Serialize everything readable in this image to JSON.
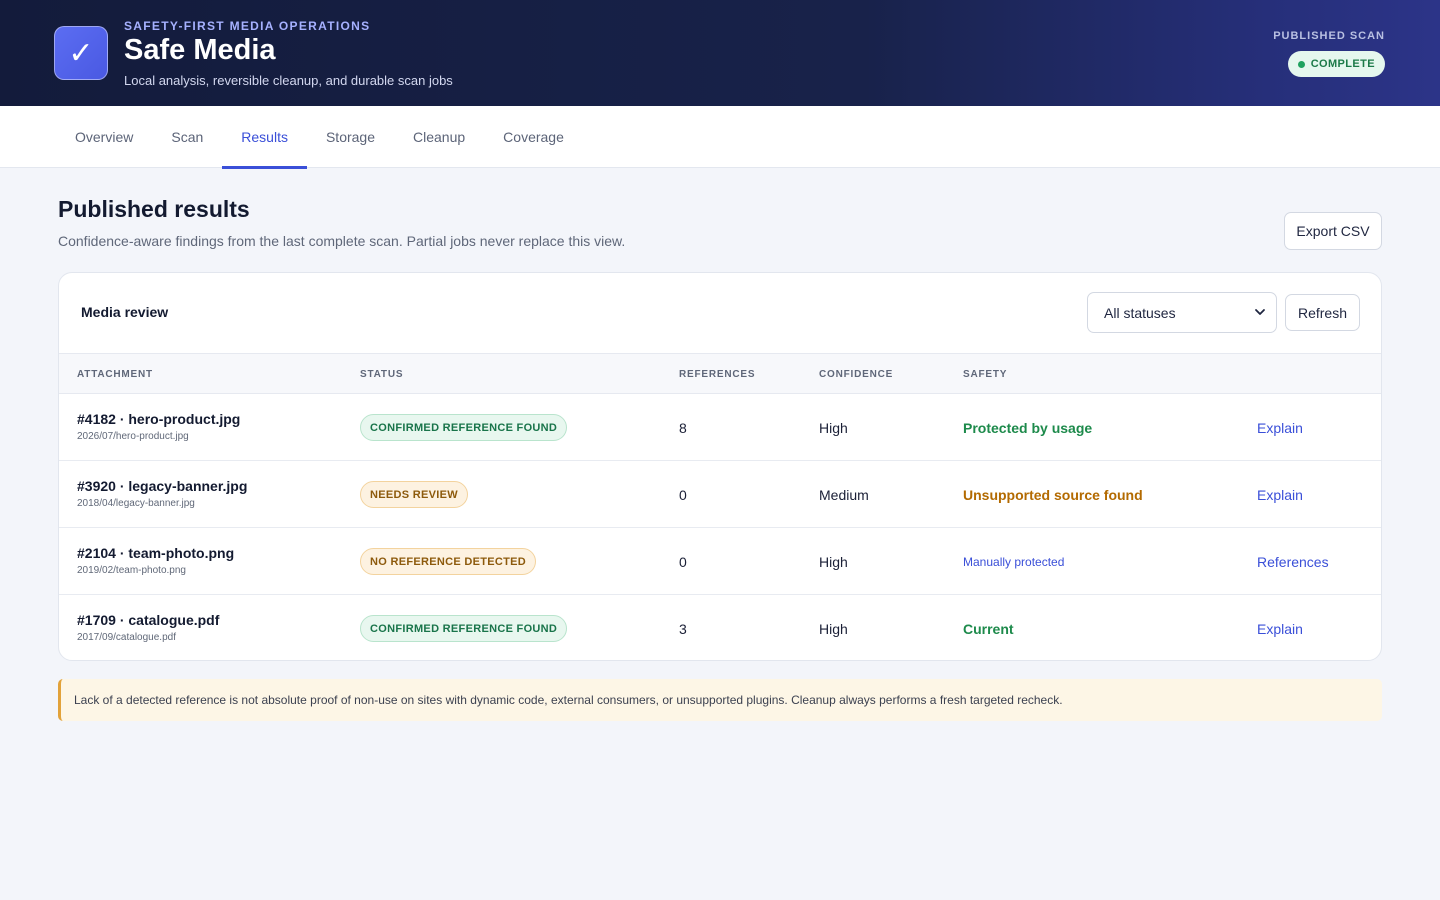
{
  "header": {
    "eyebrow": "SAFETY-FIRST MEDIA OPERATIONS",
    "title": "Safe Media",
    "subtitle": "Local analysis, reversible cleanup, and durable scan jobs",
    "logo_glyph": "✓",
    "scan_label": "PUBLISHED SCAN",
    "scan_status": "COMPLETE"
  },
  "tabs": [
    {
      "label": "Overview"
    },
    {
      "label": "Scan"
    },
    {
      "label": "Results",
      "active": true
    },
    {
      "label": "Storage"
    },
    {
      "label": "Cleanup"
    },
    {
      "label": "Coverage"
    }
  ],
  "main": {
    "title": "Published results",
    "description": "Confidence-aware findings from the last complete scan. Partial jobs never replace this view.",
    "export_label": "Export CSV"
  },
  "card": {
    "title": "Media review",
    "filter_value": "All statuses",
    "refresh_label": "Refresh"
  },
  "table": {
    "columns": [
      "ATTACHMENT",
      "STATUS",
      "REFERENCES",
      "CONFIDENCE",
      "SAFETY"
    ],
    "rows": [
      {
        "name": "#4182 · hero-product.jpg",
        "path": "2026/07/hero-product.jpg",
        "status": "CONFIRMED REFERENCE FOUND",
        "references": "8",
        "confidence": "High",
        "safety": "Protected by usage",
        "action": "Explain"
      },
      {
        "name": "#3920 · legacy-banner.jpg",
        "path": "2018/04/legacy-banner.jpg",
        "status": "NEEDS REVIEW",
        "references": "0",
        "confidence": "Medium",
        "safety": "Unsupported source found",
        "action": "Explain"
      },
      {
        "name": "#2104 · team-photo.png",
        "path": "2019/02/team-photo.png",
        "status": "NO REFERENCE DETECTED",
        "references": "0",
        "confidence": "High",
        "safety": "Manually protected",
        "action": "References"
      },
      {
        "name": "#1709 · catalogue.pdf",
        "path": "2017/09/catalogue.pdf",
        "status": "CONFIRMED REFERENCE FOUND",
        "references": "3",
        "confidence": "High",
        "safety": "Current",
        "action": "Explain"
      }
    ]
  },
  "notice": "Lack of a detected reference is not absolute proof of non-use on sites with dynamic code, external consumers, or unsupported plugins. Cleanup always performs a fresh targeted recheck.",
  "colors": {
    "accent": "#3a4fd8",
    "success": "#1d8a4b",
    "warning": "#b36a00",
    "header_bg": "#131b3b"
  }
}
